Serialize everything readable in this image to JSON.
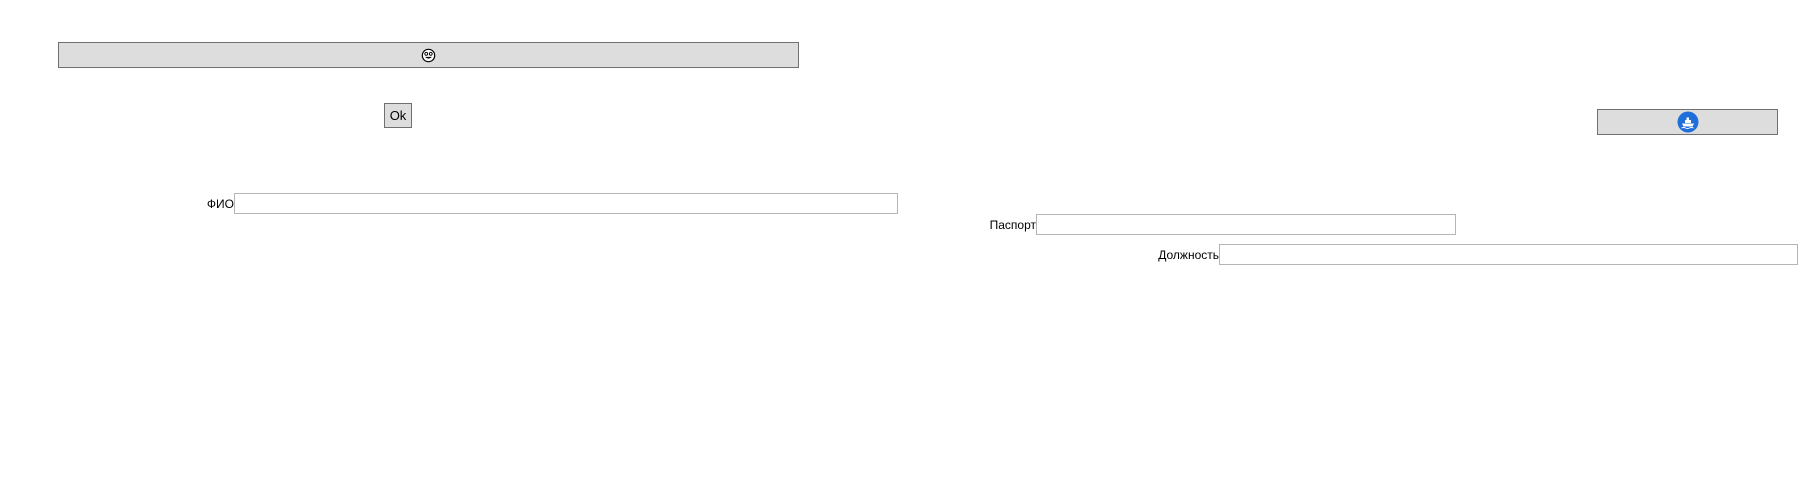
{
  "buttons": {
    "top": {
      "icon": "face-emoji-icon"
    },
    "ok": {
      "label": "Ok"
    },
    "right": {
      "icon": "ship-icon",
      "color": "#1e6fd9"
    }
  },
  "form": {
    "fio": {
      "label": "ФИО",
      "value": ""
    },
    "passport": {
      "label": "Паспорт",
      "value": ""
    },
    "position": {
      "label": "Должность",
      "value": ""
    }
  }
}
